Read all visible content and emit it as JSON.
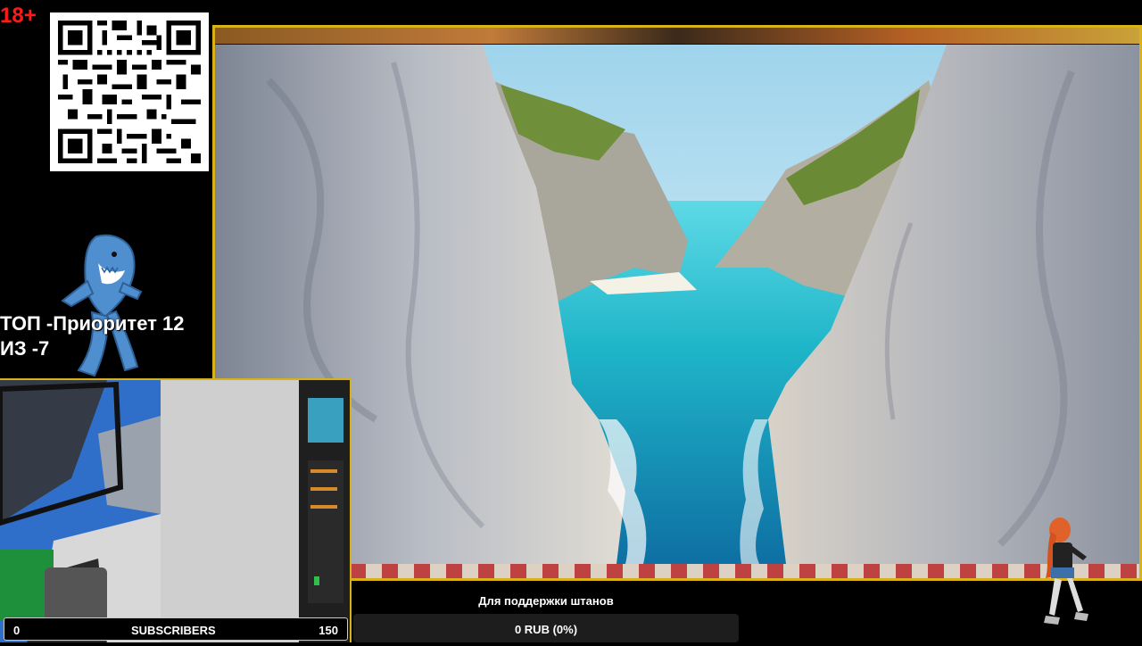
{
  "age_rating": "18+",
  "overlay": {
    "top_line": "ТОП -Приоритет 12",
    "second_line": "ИЗ -7"
  },
  "subscribers": {
    "current": "0",
    "label": "SUBSCRIBERS",
    "goal": "150"
  },
  "donation": {
    "title": "Для поддержки штанов",
    "progress_text": "0 RUB (0%)",
    "progress_fraction": 0
  },
  "colors": {
    "age_red": "#ff1a1a",
    "frame_gold": "#d9b21a",
    "sea": "#1fb6c9"
  }
}
